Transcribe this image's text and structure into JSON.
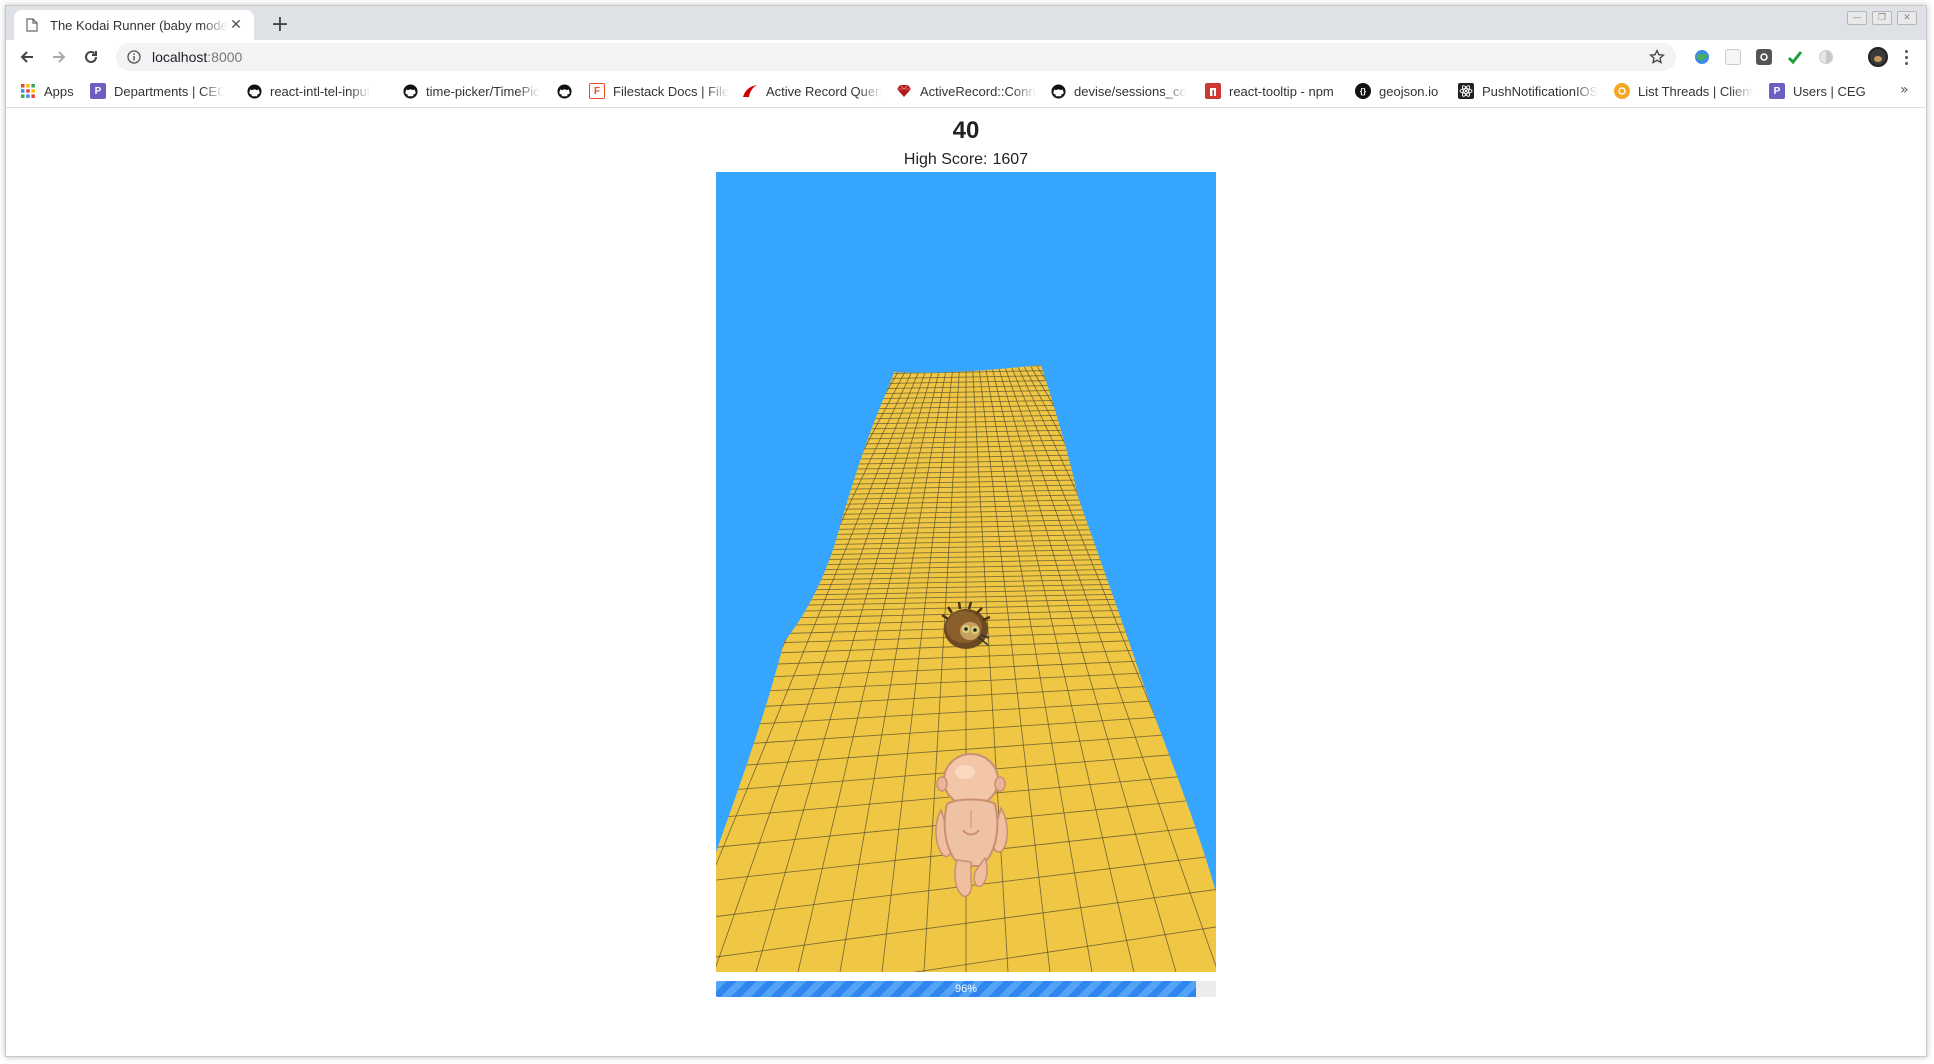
{
  "browser": {
    "tab": {
      "title": "The Kodai Runner (baby mode)",
      "close_glyph": "✕",
      "favicon": "page-icon"
    },
    "new_tab_glyph": "+",
    "window_controls": [
      "minimize-icon",
      "restore-icon",
      "close-icon"
    ],
    "nav": {
      "back": "back-arrow-icon",
      "forward": "forward-arrow-icon",
      "reload": "reload-icon"
    },
    "address": {
      "host": "localhost",
      "port": ":8000"
    },
    "extensions": [
      "globe-extension-icon",
      "grid-extension-icon",
      "shield-extension-icon",
      "checkmark-extension-icon",
      "circle-extension-icon"
    ],
    "bookmarks": [
      {
        "label": "Apps",
        "icon": "apps-grid-icon"
      },
      {
        "label": "Departments | CEG",
        "icon": "p-logo-icon",
        "icon_text": "P",
        "color": "#6b5fbf"
      },
      {
        "label": "react-intl-tel-input",
        "icon": "github-icon"
      },
      {
        "label": "time-picker/TimePicker",
        "icon": "github-icon"
      },
      {
        "label": "",
        "icon": "github-icon"
      },
      {
        "label": "Filestack Docs | File",
        "icon": "filestack-icon",
        "icon_text": "F",
        "color": "#ef4a25"
      },
      {
        "label": "Active Record Query",
        "icon": "rails-icon",
        "color": "#cc0000"
      },
      {
        "label": "ActiveRecord::Conn",
        "icon": "ruby-icon",
        "color": "#b11d1d"
      },
      {
        "label": "devise/sessions_co",
        "icon": "github-icon"
      },
      {
        "label": "react-tooltip - npm",
        "icon": "npm-icon",
        "color": "#cb3837"
      },
      {
        "label": "geojson.io",
        "icon": "geojson-icon",
        "icon_text": "{}",
        "color": "#111111"
      },
      {
        "label": "PushNotificationIOS",
        "icon": "react-icon",
        "color": "#222222"
      },
      {
        "label": "List Threads | Client",
        "icon": "orange-circle-icon",
        "color": "#f5a623"
      },
      {
        "label": "Users | CEG",
        "icon": "p-logo-icon",
        "icon_text": "P",
        "color": "#6b5fbf"
      }
    ],
    "bookmarks_more_glyph": "»"
  },
  "game": {
    "score": "40",
    "high_score_label": "High Score:",
    "high_score_value": "1607",
    "progress_percent": 96,
    "progress_label": "96%",
    "colors": {
      "sky": "#36a5fe",
      "track": "#f0c744",
      "track_grid": "#5a5030",
      "progress": "#2f86ee"
    },
    "sprites": [
      "baby-runner-sprite",
      "hedgehog-obstacle-sprite"
    ]
  }
}
